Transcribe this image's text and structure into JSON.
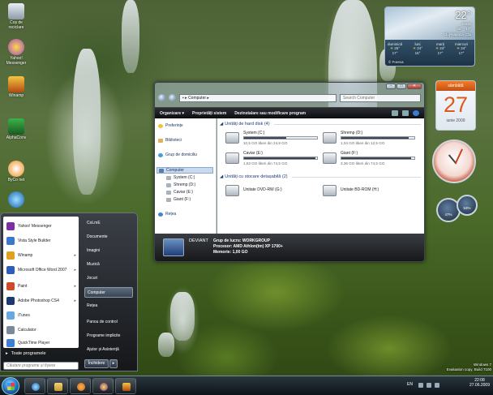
{
  "desktop": {
    "icons": [
      {
        "label": "Coș de reciclare"
      },
      {
        "label": "Yahoo! Messenger"
      },
      {
        "label": "Winamp"
      },
      {
        "label": "AlphaConv"
      },
      {
        "label": "ByCo net"
      }
    ]
  },
  "explorer": {
    "address": "Computer",
    "search_placeholder": "Search Computer",
    "toolbar": [
      "Organizare",
      "Proprietăți sistem",
      "Dezinstalare sau modificare program"
    ],
    "nav": {
      "favorites": "Preferințe",
      "libraries": "Biblioteci",
      "homegroup": "Grup de domiciliu",
      "computer": "Computer",
      "drives": [
        "System (C:)",
        "Shremp (D:)",
        "Caviar (E:)",
        "Giant (F:)"
      ],
      "network": "Rețea"
    },
    "hard_disks_header": "Unități de hard disk (4)",
    "hard_disks": [
      {
        "name": "System (C:)",
        "free": "10,5 GO liberi din 24,9 GO",
        "used_fraction": 0.58
      },
      {
        "name": "Shremp (D:)",
        "free": "1,04 GO liberi din 12,5 GO",
        "used_fraction": 0.92
      },
      {
        "name": "Caviar (E:)",
        "free": "1,53 GO liberi din 74,5 GO",
        "used_fraction": 0.98
      },
      {
        "name": "Giant (F:)",
        "free": "3,36 GO liberi din 74,5 GO",
        "used_fraction": 0.95
      }
    ],
    "removable_header": "Unități cu stocare detașabilă (2)",
    "removable": [
      {
        "name": "Unitate DVD-RW (G:)"
      },
      {
        "name": "Unitate BD-ROM (H:)"
      }
    ],
    "details": {
      "computer_name": "DEVIANT",
      "workgroup": "Grup de lucru: WORKGROUP",
      "processor": "Procesor: AMD Athlon(tm) XP 1700+",
      "memory": "Memorie: 1,00 GO"
    }
  },
  "weather": {
    "temp": "22°",
    "condition": "Senin",
    "range": "25° - 17°",
    "location": "Cluj-Napoca, Clu",
    "credit": "© Foreca",
    "days": [
      {
        "name": "duminică",
        "hi": "25°",
        "lo": "17°"
      },
      {
        "name": "luni",
        "hi": "24°",
        "lo": "16°"
      },
      {
        "name": "marți",
        "hi": "24°",
        "lo": "17°"
      },
      {
        "name": "miercuri",
        "hi": "24°",
        "lo": "17°"
      }
    ]
  },
  "calendar": {
    "weekday": "sâmbătă",
    "day": "27",
    "month": "iunie 2009"
  },
  "meters": {
    "cpu": "47%",
    "mem": "53%"
  },
  "start_menu": {
    "left_items": [
      {
        "label": "Yahoo! Messenger",
        "color": "#7b2fa0",
        "arrow": false
      },
      {
        "label": "Vista Style Builder",
        "color": "#3a78c9",
        "arrow": false
      },
      {
        "label": "Winamp",
        "color": "#e0a020",
        "arrow": true
      },
      {
        "label": "Microsoft Office Word 2007",
        "color": "#2d5db8",
        "arrow": true
      },
      {
        "label": "Paint",
        "color": "#d04a2a",
        "arrow": true
      },
      {
        "label": "Adobe Photoshop CS4",
        "color": "#1d3a6e",
        "arrow": true
      },
      {
        "label": "iTunes",
        "color": "#6aa8e0",
        "arrow": false
      },
      {
        "label": "Calculator",
        "color": "#7a8a9a",
        "arrow": false
      },
      {
        "label": "QuickTime Player",
        "color": "#3d7fd0",
        "arrow": false
      }
    ],
    "all_programs": "Toate programele",
    "search_placeholder": "Căutare programe și fișiere",
    "right_items": [
      "CoLmE",
      "Documente",
      "Imagini",
      "Muzică",
      "Jocuri",
      "Computer",
      "Rețea",
      "Panou de control",
      "Programe implicite",
      "Ajutor și Asistență"
    ],
    "highlighted": "Computer",
    "shutdown": "Închidere"
  },
  "taskbar": {
    "lang": "EN",
    "time": "22:08",
    "date": "27.06.2009"
  },
  "watermark": {
    "line1": "Windows 7",
    "line2": "Evaluation copy. Build 7100"
  }
}
